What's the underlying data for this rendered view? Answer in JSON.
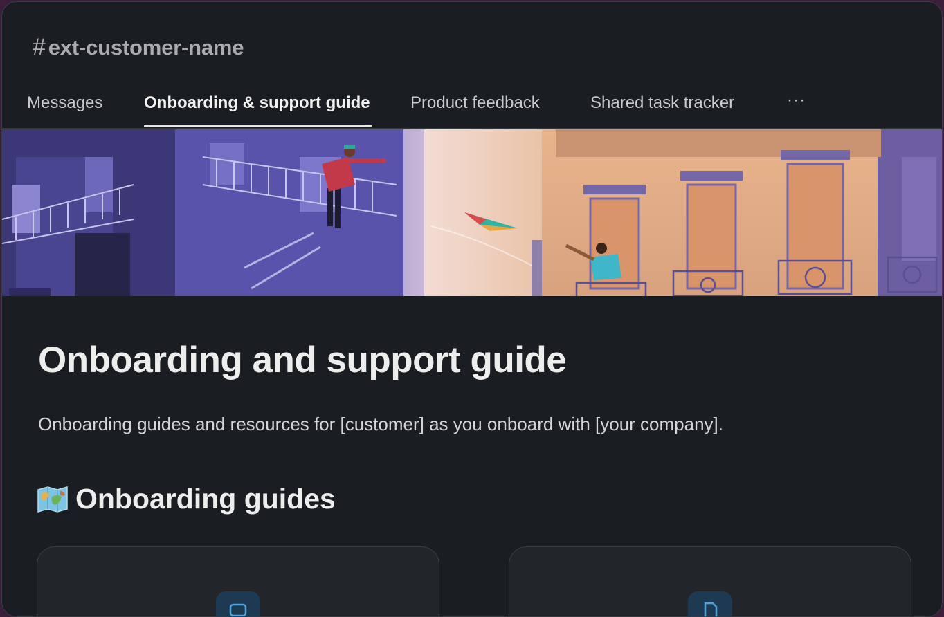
{
  "channel": {
    "hash": "#",
    "name": "ext-customer-name"
  },
  "tabs": [
    {
      "label": "Messages",
      "active": false
    },
    {
      "label": "Onboarding & support guide",
      "active": true
    },
    {
      "label": "Product feedback",
      "active": false
    },
    {
      "label": "Shared task tracker",
      "active": false
    }
  ],
  "tabs_more": "···",
  "canvas": {
    "title": "Onboarding and support guide",
    "description": "Onboarding guides and resources for [customer] as you onboard with [your company].",
    "section": {
      "icon": "world-map-icon",
      "title": "Onboarding guides"
    },
    "cards": [
      {
        "icon": "message-icon"
      },
      {
        "icon": "document-icon"
      }
    ]
  },
  "colors": {
    "background": "#1a1d21",
    "text_primary": "#ededed",
    "card_icon_bg": "#1d3a52"
  }
}
